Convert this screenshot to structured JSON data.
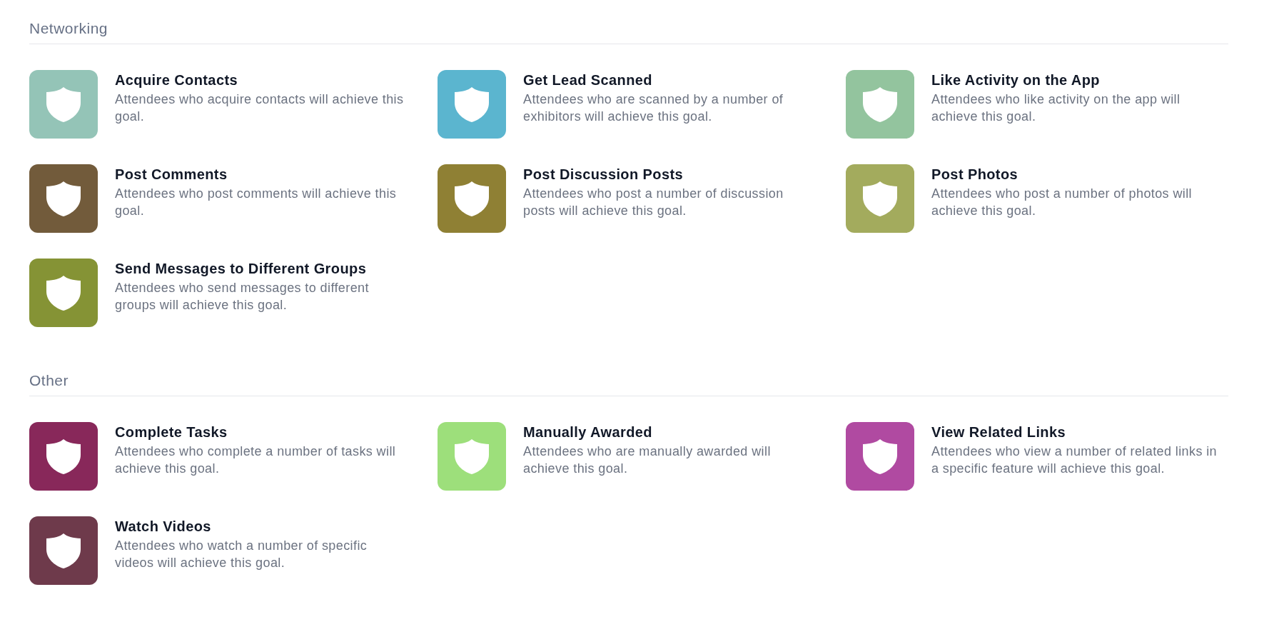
{
  "sections": [
    {
      "heading": "Networking",
      "goals": [
        {
          "title": "Acquire Contacts",
          "description": "Attendees who acquire contacts will achieve this goal.",
          "color": "#94c4b7"
        },
        {
          "title": "Get Lead Scanned",
          "description": "Attendees who are scanned by a number of exhibitors will achieve this goal.",
          "color": "#5bb5cf"
        },
        {
          "title": "Like Activity on the App",
          "description": "Attendees who like activity on the app will achieve this goal.",
          "color": "#93c49e"
        },
        {
          "title": "Post Comments",
          "description": "Attendees who post comments will achieve this goal.",
          "color": "#725b3b"
        },
        {
          "title": "Post Discussion Posts",
          "description": "Attendees who post a number of discussion posts will achieve this goal.",
          "color": "#8f8034"
        },
        {
          "title": "Post Photos",
          "description": "Attendees who post a number of photos will achieve this goal.",
          "color": "#a3ab5d"
        },
        {
          "title": "Send Messages to Different Groups",
          "description": "Attendees who send messages to different groups will achieve this goal.",
          "color": "#859335"
        }
      ]
    },
    {
      "heading": "Other",
      "goals": [
        {
          "title": "Complete Tasks",
          "description": "Attendees who complete a number of tasks will achieve this goal.",
          "color": "#88285a"
        },
        {
          "title": "Manually Awarded",
          "description": "Attendees who are manually awarded will achieve this goal.",
          "color": "#9ddf7b"
        },
        {
          "title": "View Related Links",
          "description": "Attendees who view a number of related links in a specific feature will achieve this goal.",
          "color": "#b04aa1"
        },
        {
          "title": "Watch Videos",
          "description": "Attendees who watch a number of specific videos will achieve this goal.",
          "color": "#6e3a4b"
        }
      ]
    }
  ]
}
